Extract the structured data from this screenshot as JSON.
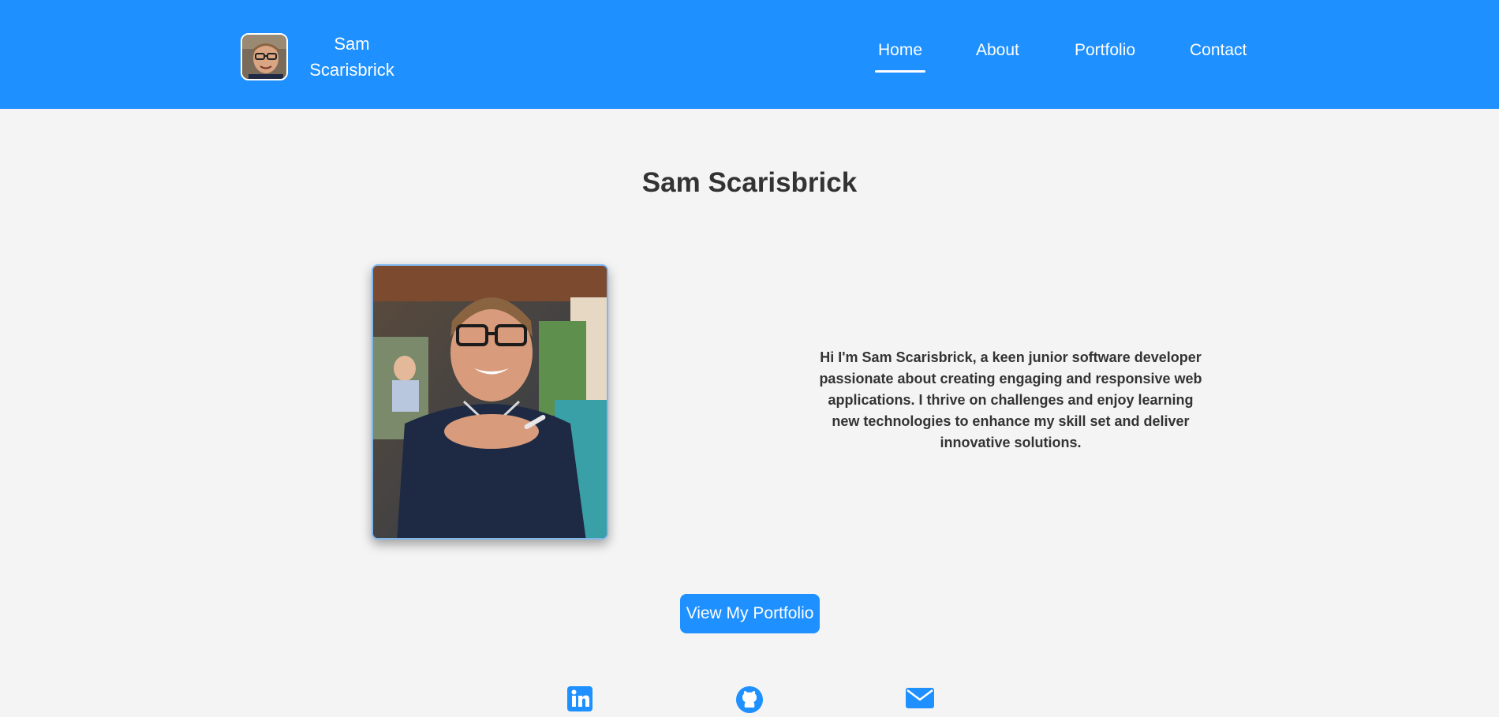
{
  "header": {
    "brand_name": "Sam Scarisbrick",
    "background": "#1e90ff",
    "nav": [
      {
        "label": "Home",
        "active": true
      },
      {
        "label": "About",
        "active": false
      },
      {
        "label": "Portfolio",
        "active": false
      },
      {
        "label": "Contact",
        "active": false
      }
    ]
  },
  "main": {
    "title": "Sam Scarisbrick",
    "bio": "Hi I'm Sam Scarisbrick, a keen junior software developer passionate about creating engaging and responsive web applications. I thrive on challenges and enjoy learning new technologies to enhance my skill set and deliver innovative solutions.",
    "cta_label": "View My Portfolio"
  },
  "social": {
    "icons": [
      "linkedin-icon",
      "github-icon",
      "mail-icon"
    ],
    "color": "#1e90ff"
  }
}
